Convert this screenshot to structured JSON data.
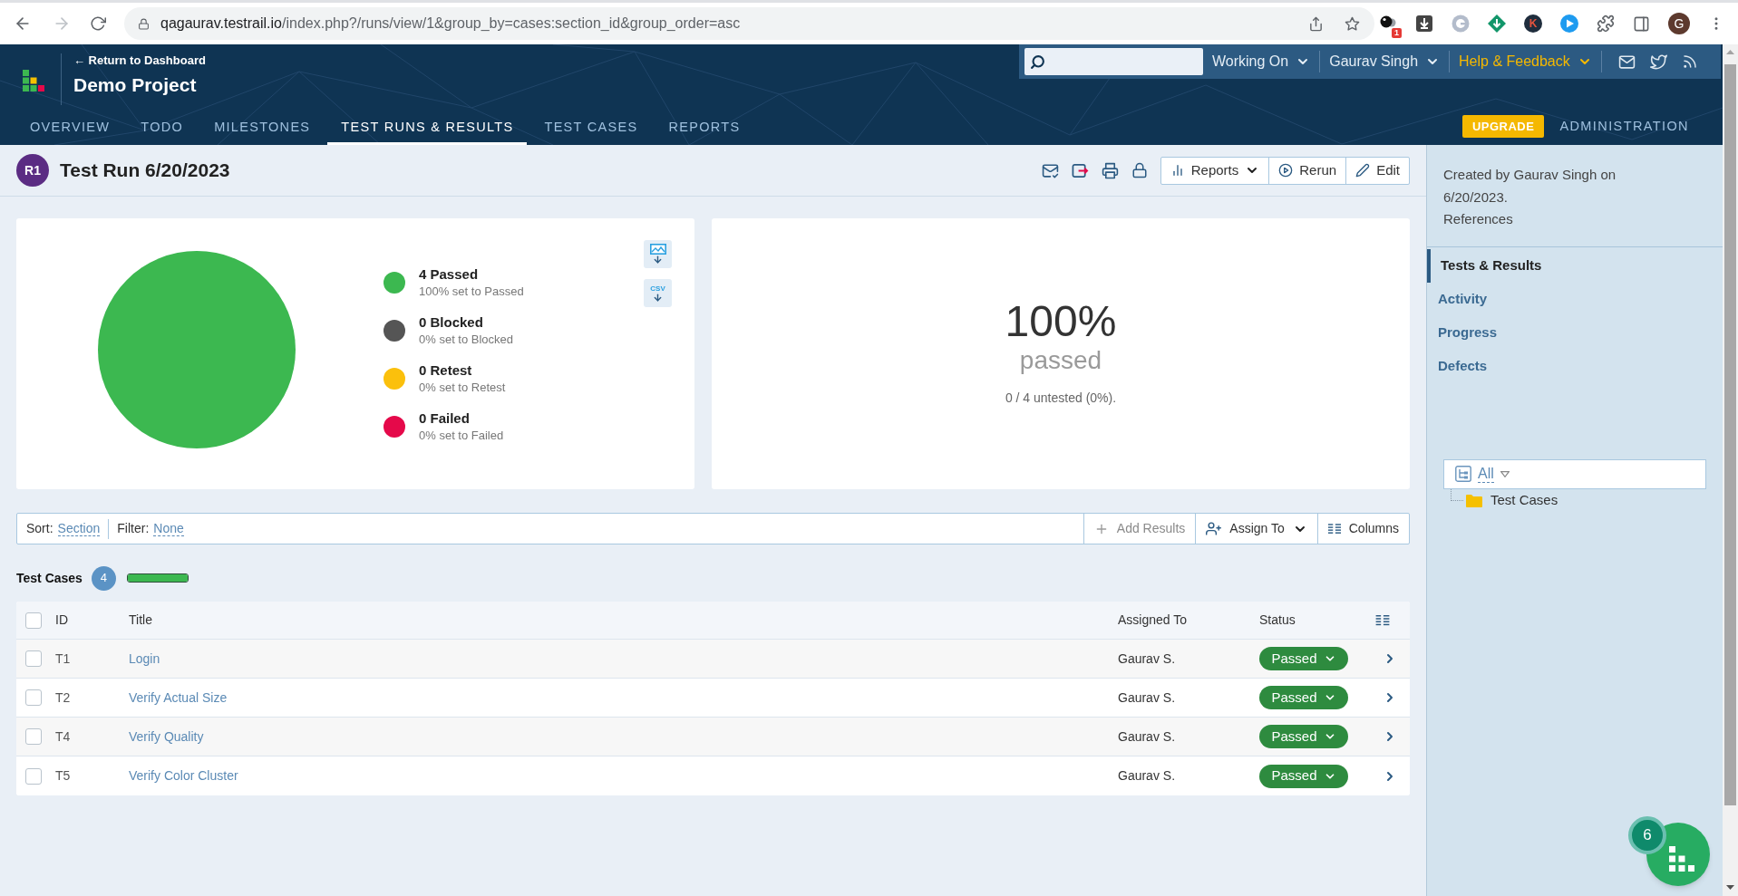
{
  "browser": {
    "url": {
      "host": "qagaurav.testrail.io",
      "path": "/index.php?/runs/view/1&group_by=cases:section_id&group_order=asc"
    },
    "extensions": [
      {
        "kind": "ball",
        "badge": "1"
      },
      {
        "kind": "download"
      },
      {
        "kind": "ring"
      },
      {
        "kind": "diamond"
      },
      {
        "kind": "letter",
        "letter": "K"
      },
      {
        "kind": "play"
      }
    ],
    "profile_initial": "G"
  },
  "header": {
    "back_link": "← Return to Dashboard",
    "project": "Demo Project",
    "menus": [
      {
        "label": "Working On",
        "highlighted": false
      },
      {
        "label": "Gaurav Singh",
        "highlighted": false
      },
      {
        "label": "Help & Feedback",
        "highlighted": true
      }
    ],
    "tabs": [
      {
        "label": "OVERVIEW",
        "selected": false
      },
      {
        "label": "TODO",
        "selected": false
      },
      {
        "label": "MILESTONES",
        "selected": false
      },
      {
        "label": "TEST RUNS & RESULTS",
        "selected": true
      },
      {
        "label": "TEST CASES",
        "selected": false
      },
      {
        "label": "REPORTS",
        "selected": false
      }
    ],
    "upgrade": "UPGRADE",
    "administration": "ADMINISTRATION"
  },
  "run": {
    "badge": "R1",
    "title": "Test Run 6/20/2023",
    "buttons": [
      {
        "label": "Reports",
        "dropdown": true
      },
      {
        "label": "Rerun",
        "dropdown": false
      },
      {
        "label": "Edit",
        "dropdown": false
      }
    ]
  },
  "summary": {
    "chart_data": {
      "type": "pie",
      "values": [
        100,
        0,
        0,
        0
      ]
    },
    "legend": [
      {
        "title": "4 Passed",
        "subtitle": "100% set to Passed",
        "color": "#3cb850"
      },
      {
        "title": "0 Blocked",
        "subtitle": "0% set to Blocked",
        "color": "#555555"
      },
      {
        "title": "0 Retest",
        "subtitle": "0% set to Retest",
        "color": "#fbc00c"
      },
      {
        "title": "0 Failed",
        "subtitle": "0% set to Failed",
        "color": "#e5094a"
      }
    ],
    "csv_label": "CSV",
    "percent": "100%",
    "percent_label": "passed",
    "untested": "0 / 4 untested (0%)."
  },
  "toolbar": {
    "sort_label": "Sort:",
    "sort_value": "Section",
    "filter_label": "Filter:",
    "filter_value": "None",
    "buttons": [
      {
        "label": "Add Results",
        "disabled": true,
        "dropdown": false
      },
      {
        "label": "Assign To",
        "disabled": false,
        "dropdown": true
      },
      {
        "label": "Columns",
        "disabled": false,
        "dropdown": false
      }
    ]
  },
  "section": {
    "title": "Test Cases",
    "count": "4",
    "level": 1
  },
  "table": {
    "select_all_checked": false,
    "columns": [
      "ID",
      "Title",
      "Assigned To",
      "Status"
    ],
    "rows": [
      {
        "checked": false,
        "id": "T1",
        "title": "Login",
        "assigned_to": "Gaurav S.",
        "status": "Passed"
      },
      {
        "checked": false,
        "id": "T2",
        "title": "Verify Actual Size",
        "assigned_to": "Gaurav S.",
        "status": "Passed"
      },
      {
        "checked": false,
        "id": "T4",
        "title": "Verify Quality",
        "assigned_to": "Gaurav S.",
        "status": "Passed"
      },
      {
        "checked": false,
        "id": "T5",
        "title": "Verify Color Cluster",
        "assigned_to": "Gaurav S.",
        "status": "Passed"
      }
    ]
  },
  "sidebar": {
    "created": "Created by Gaurav Singh on 6/20/2023.",
    "references": "References",
    "nav": [
      {
        "label": "Tests & Results",
        "selected": true
      },
      {
        "label": "Activity",
        "selected": false
      },
      {
        "label": "Progress",
        "selected": false
      },
      {
        "label": "Defects",
        "selected": false
      }
    ],
    "tree_filter": "All",
    "tree": [
      {
        "label": "Test Cases"
      }
    ]
  },
  "widget": {
    "badge": "6"
  }
}
